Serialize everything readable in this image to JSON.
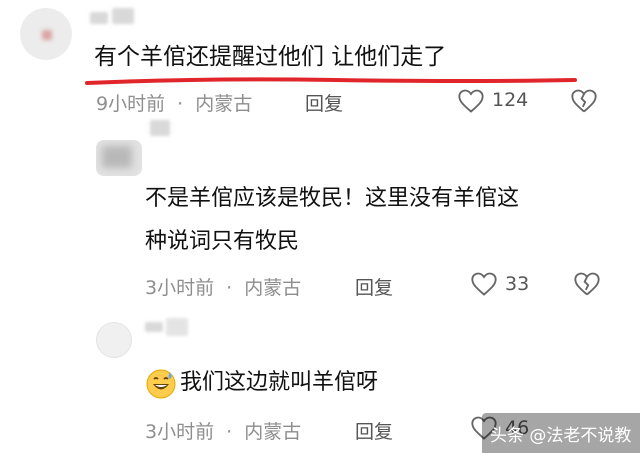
{
  "comments": [
    {
      "text": "有个羊倌还提醒过他们 让他们走了",
      "time": "9小时前",
      "location": "内蒙古",
      "reply": "回复",
      "likes": "124",
      "highlight_color": "#e1262b"
    },
    {
      "text_line1": "不是羊倌应该是牧民！这里没有羊倌这",
      "text_line2": "种说词只有牧民",
      "time": "3小时前",
      "location": "内蒙古",
      "reply": "回复",
      "likes": "33"
    },
    {
      "emoji": "grinning-sweat-emoji",
      "text": "我们这边就叫羊倌呀",
      "time": "3小时前",
      "location": "内蒙古",
      "reply": "回复",
      "likes": "46"
    }
  ],
  "separator": "·",
  "watermark": "头条 @法老不说教",
  "icons": [
    "heart-icon",
    "broken-heart-icon"
  ]
}
